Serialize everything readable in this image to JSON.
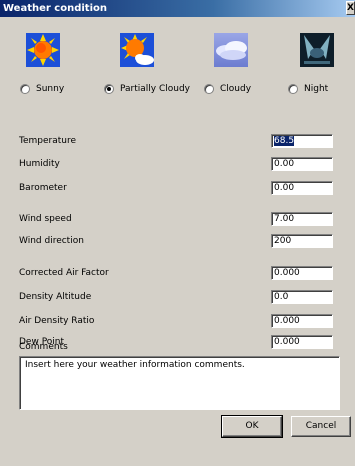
{
  "window": {
    "title": "Weather condition",
    "close_label": "X"
  },
  "conditions": [
    {
      "label": "Sunny",
      "icon": "sun-icon",
      "selected": false
    },
    {
      "label": "Partially Cloudy",
      "icon": "sun-cloud-icon",
      "selected": true
    },
    {
      "label": "Cloudy",
      "icon": "cloud-icon",
      "selected": false
    },
    {
      "label": "Night",
      "icon": "night-icon",
      "selected": false
    }
  ],
  "fields": {
    "temperature": {
      "label": "Temperature",
      "value": "68.5"
    },
    "humidity": {
      "label": "Humidity",
      "value": "0.00"
    },
    "barometer": {
      "label": "Barometer",
      "value": "0.00"
    },
    "wind_speed": {
      "label": "Wind speed",
      "value": "7.00"
    },
    "wind_direction": {
      "label": "Wind direction",
      "value": "200"
    },
    "corrected_air_factor": {
      "label": "Corrected Air Factor",
      "value": "0.000"
    },
    "density_altitude": {
      "label": "Density Altitude",
      "value": "0.0"
    },
    "air_density_ratio": {
      "label": "Air Density Ratio",
      "value": "0.000"
    },
    "dew_point": {
      "label": "Dew Point",
      "value": "0.000"
    }
  },
  "comments": {
    "label": "Comments",
    "value": "Insert here your weather information comments."
  },
  "buttons": {
    "ok": "OK",
    "cancel": "Cancel"
  }
}
